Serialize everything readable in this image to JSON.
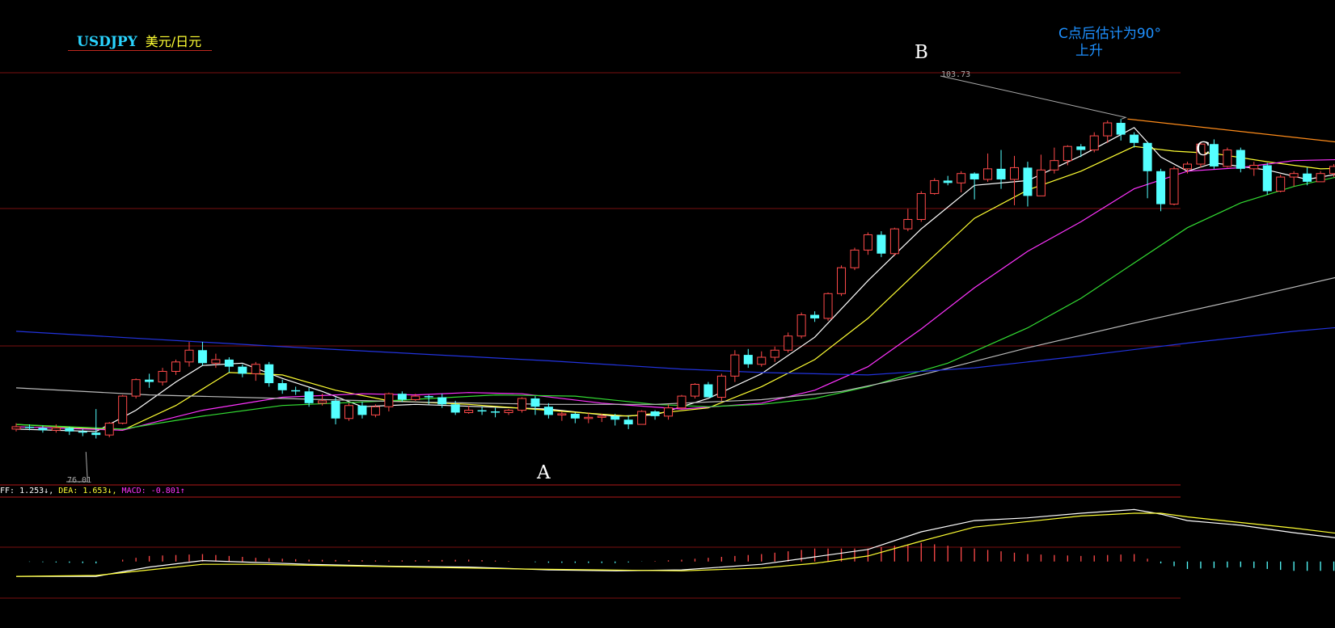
{
  "header": {
    "symbol": "USDJPY",
    "name": "美元/日元"
  },
  "annotations": {
    "note_line1": "C点后估计为90°",
    "note_line2": "上升",
    "point_a": "A",
    "point_b": "B",
    "point_c": "C",
    "high_label": "103.73",
    "low_label": "76.01"
  },
  "macd_legend": {
    "dif": "FF: 1.253↓,",
    "dea": "DEA: 1.653↓,",
    "macd": "MACD: -0.801↑"
  },
  "colors": {
    "bg": "#000000",
    "up": "#ff4a4a",
    "down": "#54ffff",
    "ma5": "#ffffff",
    "ma10": "#ffff33",
    "ma20": "#ff33ff",
    "ma30": "#33dd33",
    "ma60": "#bbbbbb",
    "ma120": "#2233dd",
    "trend": "#ff8c1a",
    "grid": "#7a0f0f"
  },
  "chart_data": {
    "type": "candlestick",
    "ylim": [
      73,
      108
    ],
    "grid": true,
    "highest": 103.73,
    "lowest": 76.01,
    "candles": [
      [
        77.4,
        77.6,
        77.9,
        77.2
      ],
      [
        77.6,
        77.5,
        77.8,
        77.3
      ],
      [
        77.5,
        77.3,
        77.7,
        77.1
      ],
      [
        77.3,
        77.5,
        77.8,
        77.1
      ],
      [
        77.5,
        77.2,
        77.6,
        76.9
      ],
      [
        77.2,
        77.1,
        77.4,
        76.8
      ],
      [
        77.1,
        76.9,
        79.1,
        76.6
      ],
      [
        76.9,
        77.9,
        78.0,
        76.7
      ],
      [
        77.9,
        80.2,
        80.3,
        77.8
      ],
      [
        80.2,
        81.6,
        81.7,
        80.0
      ],
      [
        81.6,
        81.4,
        82.1,
        80.9
      ],
      [
        81.4,
        82.3,
        82.6,
        81.1
      ],
      [
        82.3,
        83.1,
        83.3,
        82.0
      ],
      [
        83.1,
        84.1,
        84.8,
        82.7
      ],
      [
        84.1,
        83.0,
        84.8,
        82.8
      ],
      [
        83.0,
        83.3,
        83.8,
        82.6
      ],
      [
        83.3,
        82.7,
        83.5,
        82.2
      ],
      [
        82.7,
        82.1,
        82.9,
        81.8
      ],
      [
        82.1,
        82.9,
        83.1,
        81.5
      ],
      [
        82.9,
        81.3,
        83.1,
        81.0
      ],
      [
        81.3,
        80.7,
        81.6,
        80.4
      ],
      [
        80.7,
        80.6,
        81.0,
        80.3
      ],
      [
        80.6,
        79.6,
        80.9,
        79.3
      ],
      [
        79.6,
        79.8,
        80.4,
        79.4
      ],
      [
        79.8,
        78.3,
        80.1,
        77.8
      ],
      [
        78.3,
        79.4,
        79.6,
        78.1
      ],
      [
        79.4,
        78.6,
        79.7,
        78.3
      ],
      [
        78.6,
        79.3,
        79.5,
        78.4
      ],
      [
        79.3,
        80.4,
        80.5,
        78.9
      ],
      [
        80.4,
        79.9,
        80.6,
        79.7
      ],
      [
        79.9,
        80.2,
        80.4,
        79.8
      ],
      [
        80.2,
        80.1,
        80.3,
        79.5
      ],
      [
        80.1,
        79.5,
        80.4,
        79.2
      ],
      [
        79.5,
        78.8,
        79.8,
        78.6
      ],
      [
        78.8,
        79.0,
        79.4,
        78.7
      ],
      [
        79.0,
        78.9,
        79.3,
        78.6
      ],
      [
        78.9,
        78.8,
        79.2,
        78.4
      ],
      [
        78.8,
        79.0,
        79.1,
        78.6
      ],
      [
        79.0,
        80.0,
        80.1,
        78.8
      ],
      [
        80.0,
        79.3,
        80.2,
        78.6
      ],
      [
        79.3,
        78.6,
        79.6,
        78.3
      ],
      [
        78.6,
        78.7,
        78.9,
        78.1
      ],
      [
        78.7,
        78.3,
        78.8,
        77.9
      ],
      [
        78.3,
        78.4,
        78.8,
        77.9
      ],
      [
        78.4,
        78.5,
        78.7,
        78.0
      ],
      [
        78.5,
        78.2,
        78.7,
        77.7
      ],
      [
        78.2,
        77.8,
        78.5,
        77.4
      ],
      [
        77.8,
        78.9,
        79.0,
        77.8
      ],
      [
        78.9,
        78.5,
        79.0,
        78.2
      ],
      [
        78.5,
        79.2,
        79.5,
        78.2
      ],
      [
        79.2,
        80.2,
        80.3,
        79.1
      ],
      [
        80.2,
        81.2,
        81.3,
        80.0
      ],
      [
        81.2,
        80.1,
        81.4,
        80.1
      ],
      [
        80.1,
        81.9,
        82.1,
        79.8
      ],
      [
        81.9,
        83.7,
        84.1,
        81.4
      ],
      [
        83.7,
        82.9,
        84.2,
        82.6
      ],
      [
        82.9,
        83.5,
        84.0,
        82.7
      ],
      [
        83.5,
        84.1,
        84.4,
        83.1
      ],
      [
        84.1,
        85.3,
        85.6,
        83.9
      ],
      [
        85.3,
        87.1,
        87.3,
        85.1
      ],
      [
        87.1,
        86.8,
        87.4,
        86.5
      ],
      [
        86.8,
        88.9,
        89.0,
        86.6
      ],
      [
        88.9,
        91.1,
        91.3,
        88.7
      ],
      [
        91.1,
        92.6,
        92.8,
        90.9
      ],
      [
        92.6,
        93.9,
        94.1,
        92.2
      ],
      [
        93.9,
        92.3,
        94.2,
        92.0
      ],
      [
        92.3,
        94.4,
        94.5,
        92.1
      ],
      [
        94.4,
        95.2,
        96.1,
        94.2
      ],
      [
        95.2,
        97.4,
        97.6,
        95.0
      ],
      [
        97.4,
        98.5,
        98.7,
        97.3
      ],
      [
        98.5,
        98.3,
        98.9,
        98.1
      ],
      [
        98.3,
        99.1,
        99.3,
        97.5
      ],
      [
        99.1,
        98.6,
        99.2,
        96.9
      ],
      [
        98.6,
        99.5,
        100.8,
        98.4
      ],
      [
        99.5,
        98.6,
        101.1,
        97.8
      ],
      [
        98.6,
        99.6,
        100.6,
        96.4
      ],
      [
        99.6,
        97.2,
        100.1,
        96.3
      ],
      [
        97.2,
        99.4,
        100.7,
        98.6
      ],
      [
        99.4,
        100.2,
        101.3,
        99.1
      ],
      [
        100.2,
        101.4,
        101.5,
        99.8
      ],
      [
        101.4,
        101.1,
        101.6,
        100.5
      ],
      [
        101.1,
        102.3,
        102.6,
        100.9
      ],
      [
        102.3,
        103.4,
        103.6,
        101.7
      ],
      [
        103.4,
        102.4,
        103.73,
        101.9
      ],
      [
        102.4,
        101.7,
        102.6,
        101.3
      ],
      [
        101.7,
        99.3,
        101.8,
        97.0
      ],
      [
        99.3,
        96.5,
        99.5,
        95.9
      ],
      [
        96.5,
        99.5,
        99.7,
        96.4
      ],
      [
        99.5,
        99.9,
        100.1,
        99.1
      ],
      [
        99.9,
        101.6,
        101.8,
        99.6
      ],
      [
        101.6,
        99.7,
        102.0,
        99.5
      ],
      [
        99.7,
        101.1,
        101.3,
        99.6
      ],
      [
        101.1,
        99.5,
        101.3,
        99.2
      ],
      [
        99.5,
        99.8,
        100.1,
        98.9
      ],
      [
        99.8,
        97.6,
        100.0,
        97.3
      ],
      [
        97.6,
        98.8,
        99.0,
        97.5
      ],
      [
        98.8,
        99.1,
        99.3,
        98.0
      ],
      [
        99.1,
        98.4,
        99.6,
        98.1
      ],
      [
        98.4,
        99.1,
        99.3,
        98.4
      ],
      [
        99.1,
        99.7,
        99.9,
        98.8
      ],
      [
        99.7,
        100.3,
        100.9,
        99.4
      ],
      [
        100.3,
        100.1,
        100.5,
        99.7
      ],
      [
        100.1,
        99.8,
        100.3,
        99.5
      ]
    ],
    "ma": {
      "ma5": [
        [
          0,
          77.4
        ],
        [
          6,
          77.2
        ],
        [
          9,
          79.0
        ],
        [
          12,
          81.4
        ],
        [
          14,
          82.8
        ],
        [
          17,
          83.0
        ],
        [
          20,
          81.7
        ],
        [
          23,
          80.6
        ],
        [
          26,
          79.3
        ],
        [
          30,
          79.5
        ],
        [
          35,
          79.3
        ],
        [
          40,
          79.1
        ],
        [
          45,
          78.5
        ],
        [
          48,
          78.6
        ],
        [
          52,
          80.0
        ],
        [
          56,
          82.1
        ],
        [
          60,
          85.2
        ],
        [
          64,
          90.0
        ],
        [
          68,
          94.4
        ],
        [
          72,
          98.1
        ],
        [
          76,
          98.5
        ],
        [
          80,
          100.6
        ],
        [
          84,
          103.0
        ],
        [
          86,
          100.5
        ],
        [
          88,
          99.3
        ],
        [
          90,
          100.0
        ],
        [
          94,
          99.4
        ],
        [
          97,
          98.6
        ],
        [
          100,
          99.2
        ],
        [
          104,
          99.9
        ]
      ],
      "ma10": [
        [
          0,
          77.8
        ],
        [
          8,
          77.3
        ],
        [
          12,
          79.4
        ],
        [
          16,
          82.2
        ],
        [
          20,
          82.0
        ],
        [
          24,
          80.7
        ],
        [
          28,
          79.8
        ],
        [
          34,
          79.5
        ],
        [
          40,
          79.0
        ],
        [
          46,
          78.5
        ],
        [
          52,
          79.2
        ],
        [
          56,
          81.0
        ],
        [
          60,
          83.3
        ],
        [
          64,
          86.8
        ],
        [
          68,
          91.1
        ],
        [
          72,
          95.3
        ],
        [
          76,
          97.7
        ],
        [
          80,
          99.3
        ],
        [
          84,
          101.4
        ],
        [
          87,
          101.0
        ],
        [
          90,
          100.8
        ],
        [
          94,
          100.1
        ],
        [
          98,
          99.5
        ],
        [
          104,
          99.7
        ]
      ],
      "ma20": [
        [
          0,
          77.6
        ],
        [
          8,
          77.3
        ],
        [
          14,
          79.0
        ],
        [
          20,
          80.1
        ],
        [
          26,
          80.4
        ],
        [
          30,
          80.3
        ],
        [
          34,
          80.5
        ],
        [
          38,
          80.4
        ],
        [
          44,
          79.6
        ],
        [
          50,
          79.1
        ],
        [
          56,
          79.6
        ],
        [
          60,
          80.7
        ],
        [
          64,
          82.7
        ],
        [
          68,
          85.9
        ],
        [
          72,
          89.4
        ],
        [
          76,
          92.5
        ],
        [
          80,
          95.0
        ],
        [
          84,
          97.8
        ],
        [
          88,
          99.3
        ],
        [
          92,
          99.6
        ],
        [
          96,
          100.2
        ],
        [
          100,
          100.3
        ],
        [
          104,
          100.1
        ]
      ],
      "ma30": [
        [
          0,
          77.8
        ],
        [
          8,
          77.4
        ],
        [
          14,
          78.5
        ],
        [
          20,
          79.4
        ],
        [
          28,
          79.8
        ],
        [
          36,
          80.3
        ],
        [
          42,
          80.2
        ],
        [
          48,
          79.5
        ],
        [
          52,
          79.3
        ],
        [
          56,
          79.5
        ],
        [
          60,
          80.0
        ],
        [
          64,
          81.0
        ],
        [
          70,
          83.0
        ],
        [
          76,
          86.0
        ],
        [
          80,
          88.5
        ],
        [
          84,
          91.5
        ],
        [
          88,
          94.5
        ],
        [
          92,
          96.6
        ],
        [
          96,
          98.0
        ],
        [
          100,
          99.0
        ],
        [
          104,
          99.6
        ]
      ],
      "ma60": [
        [
          0,
          80.9
        ],
        [
          10,
          80.3
        ],
        [
          20,
          80.0
        ],
        [
          30,
          79.7
        ],
        [
          40,
          79.5
        ],
        [
          48,
          79.5
        ],
        [
          56,
          79.9
        ],
        [
          62,
          80.6
        ],
        [
          68,
          82.0
        ],
        [
          76,
          84.3
        ],
        [
          84,
          86.4
        ],
        [
          92,
          88.4
        ],
        [
          100,
          90.5
        ],
        [
          104,
          91.6
        ]
      ],
      "ma120": [
        [
          0,
          85.7
        ],
        [
          20,
          84.4
        ],
        [
          40,
          83.2
        ],
        [
          50,
          82.5
        ],
        [
          56,
          82.2
        ],
        [
          64,
          82.0
        ],
        [
          72,
          82.6
        ],
        [
          80,
          83.6
        ],
        [
          88,
          84.7
        ],
        [
          96,
          85.7
        ],
        [
          104,
          86.5
        ]
      ]
    },
    "trendline": [
      [
        83.5,
        103.73
      ],
      [
        104.6,
        101.1
      ]
    ],
    "macd": {
      "dif": [
        [
          0,
          -1.6
        ],
        [
          6,
          -1.6
        ],
        [
          10,
          -0.6
        ],
        [
          14,
          0.1
        ],
        [
          18,
          -0.1
        ],
        [
          22,
          -0.3
        ],
        [
          28,
          -0.5
        ],
        [
          34,
          -0.6
        ],
        [
          40,
          -0.9
        ],
        [
          45,
          -1.0
        ],
        [
          50,
          -0.9
        ],
        [
          56,
          -0.3
        ],
        [
          60,
          0.5
        ],
        [
          64,
          1.3
        ],
        [
          68,
          3.2
        ],
        [
          72,
          4.4
        ],
        [
          76,
          4.7
        ],
        [
          80,
          5.2
        ],
        [
          84,
          5.6
        ],
        [
          86,
          5.1
        ],
        [
          88,
          4.4
        ],
        [
          92,
          3.9
        ],
        [
          96,
          3.1
        ],
        [
          100,
          2.4
        ],
        [
          104,
          2.2
        ]
      ],
      "dea": [
        [
          0,
          -1.6
        ],
        [
          6,
          -1.5
        ],
        [
          10,
          -0.9
        ],
        [
          14,
          -0.3
        ],
        [
          18,
          -0.3
        ],
        [
          22,
          -0.4
        ],
        [
          30,
          -0.6
        ],
        [
          38,
          -0.8
        ],
        [
          44,
          -0.9
        ],
        [
          50,
          -1.0
        ],
        [
          56,
          -0.7
        ],
        [
          60,
          -0.2
        ],
        [
          64,
          0.6
        ],
        [
          68,
          2.2
        ],
        [
          72,
          3.7
        ],
        [
          76,
          4.3
        ],
        [
          80,
          4.9
        ],
        [
          84,
          5.2
        ],
        [
          86,
          5.2
        ],
        [
          88,
          4.8
        ],
        [
          92,
          4.2
        ],
        [
          96,
          3.6
        ],
        [
          100,
          2.9
        ],
        [
          104,
          2.6
        ]
      ]
    },
    "macd_ylim": [
      -3.5,
      6.5
    ]
  }
}
